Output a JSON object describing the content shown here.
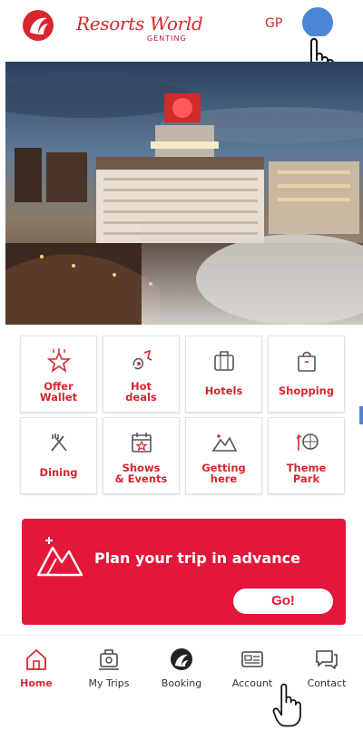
{
  "header": {
    "brand": "Resorts World",
    "brand_sub": "GENTING",
    "language": "GP"
  },
  "hero": {
    "image": "resort-hotel-photo"
  },
  "categories": [
    {
      "label": "Offer Wallet",
      "icon": "offer-wallet-icon"
    },
    {
      "label": "Hot deals",
      "icon": "hot-deals-icon"
    },
    {
      "label": "Hotels",
      "icon": "hotel-icon"
    },
    {
      "label": "Shopping",
      "icon": "shopping-bag-icon"
    },
    {
      "label": "Dining",
      "icon": "dining-icon"
    },
    {
      "label": "Shows & Events",
      "icon": "calendar-star-icon"
    },
    {
      "label": "Getting here",
      "icon": "mountain-icon"
    },
    {
      "label": "Theme Park",
      "icon": "theme-park-icon"
    }
  ],
  "promo": {
    "text": "Plan your trip in advance",
    "button": "Go!"
  },
  "tabbar": {
    "items": [
      {
        "label": "Home",
        "icon": "home-icon",
        "active": true
      },
      {
        "label": "My Trips",
        "icon": "my-trips-icon",
        "active": false
      },
      {
        "label": "Booking",
        "icon": "booking-icon",
        "active": false
      },
      {
        "label": "Account",
        "icon": "account-card-icon",
        "active": false
      },
      {
        "label": "Contact",
        "icon": "chat-icon",
        "active": false
      }
    ]
  },
  "colors": {
    "brand_red": "#d8262f",
    "promo_red": "#e4163a",
    "avatar_blue": "#4a86d4"
  }
}
